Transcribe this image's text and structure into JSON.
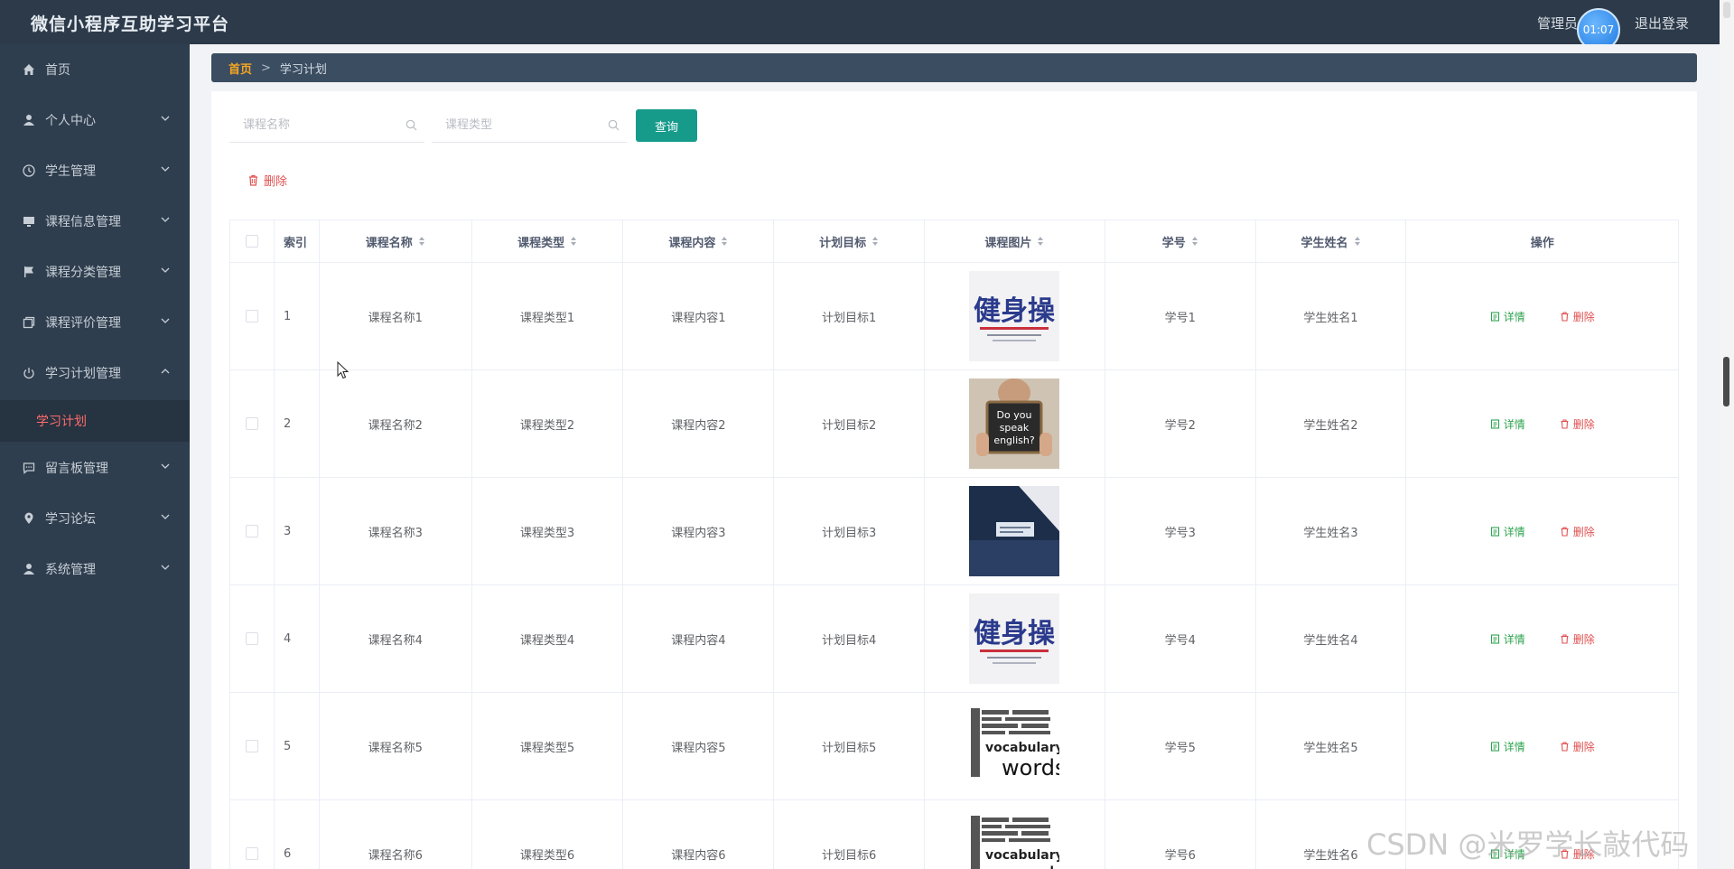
{
  "header": {
    "title": "微信小程序互助学习平台",
    "admin_label": "管理员",
    "timer": "01:07",
    "logout": "退出登录"
  },
  "sidebar": {
    "items": [
      {
        "label": "首页",
        "icon": "home-icon",
        "expandable": false
      },
      {
        "label": "个人中心",
        "icon": "user-icon",
        "expandable": true
      },
      {
        "label": "学生管理",
        "icon": "clock-icon",
        "expandable": true
      },
      {
        "label": "课程信息管理",
        "icon": "monitor-icon",
        "expandable": true
      },
      {
        "label": "课程分类管理",
        "icon": "flag-icon",
        "expandable": true
      },
      {
        "label": "课程评价管理",
        "icon": "copy-icon",
        "expandable": true
      },
      {
        "label": "学习计划管理",
        "icon": "power-icon",
        "expandable": true,
        "expanded": true
      },
      {
        "label": "留言板管理",
        "icon": "chat-icon",
        "expandable": true
      },
      {
        "label": "学习论坛",
        "icon": "location-icon",
        "expandable": true
      },
      {
        "label": "系统管理",
        "icon": "user-icon",
        "expandable": true
      }
    ],
    "active_subitem": "学习计划"
  },
  "breadcrumb": {
    "home": "首页",
    "separator": ">",
    "current": "学习计划"
  },
  "search": {
    "course_name_placeholder": "课程名称",
    "course_type_placeholder": "课程类型",
    "query_label": "查询"
  },
  "toolbar": {
    "delete_label": "删除"
  },
  "table": {
    "columns": [
      "索引",
      "课程名称",
      "课程类型",
      "课程内容",
      "计划目标",
      "课程图片",
      "学号",
      "学生姓名",
      "操作"
    ],
    "detail_label": "详情",
    "delete_label": "删除",
    "rows": [
      {
        "index": "1",
        "name": "课程名称1",
        "type": "课程类型1",
        "content": "课程内容1",
        "goal": "计划目标1",
        "image": "fitness-poster",
        "no": "学号1",
        "student": "学生姓名1"
      },
      {
        "index": "2",
        "name": "课程名称2",
        "type": "课程类型2",
        "content": "课程内容2",
        "goal": "计划目标2",
        "image": "do-you-speak-english",
        "no": "学号2",
        "student": "学生姓名2"
      },
      {
        "index": "3",
        "name": "课程名称3",
        "type": "课程类型3",
        "content": "课程内容3",
        "goal": "计划目标3",
        "image": "business-book",
        "no": "学号3",
        "student": "学生姓名3"
      },
      {
        "index": "4",
        "name": "课程名称4",
        "type": "课程类型4",
        "content": "课程内容4",
        "goal": "计划目标4",
        "image": "fitness-poster",
        "no": "学号4",
        "student": "学生姓名4"
      },
      {
        "index": "5",
        "name": "课程名称5",
        "type": "课程类型5",
        "content": "课程内容5",
        "goal": "计划目标5",
        "image": "vocabulary-words",
        "no": "学号5",
        "student": "学生姓名5"
      },
      {
        "index": "6",
        "name": "课程名称6",
        "type": "课程类型6",
        "content": "课程内容6",
        "goal": "计划目标6",
        "image": "vocabulary-words",
        "no": "学号6",
        "student": "学生姓名6"
      }
    ]
  },
  "image_texts": {
    "fitness": "健身操",
    "english": [
      "Do you",
      "speak",
      "english?"
    ],
    "vocab_word": "vocabulary",
    "vocab_words": "words"
  },
  "watermark": "CSDN @米罗学长敲代码",
  "colors": {
    "header_bg": "#2c3a4a",
    "sidebar_bg": "#2f3e4e",
    "accent": "#169b8b",
    "active_menu": "#ff6b6b",
    "danger": "#e05050",
    "success": "#2ea44f"
  }
}
